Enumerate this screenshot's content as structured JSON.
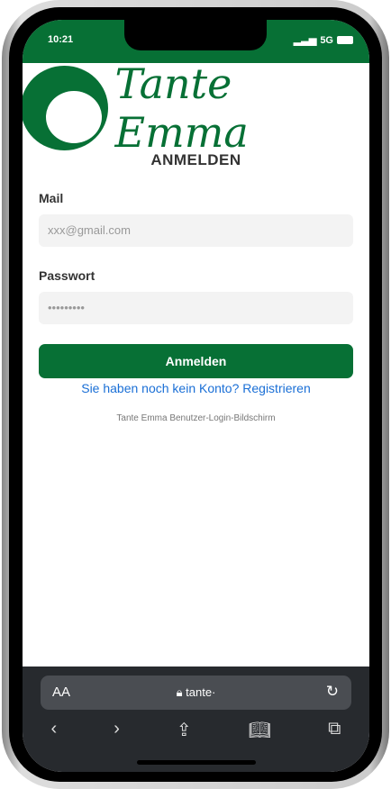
{
  "status": {
    "time": "10:21",
    "network": "5G"
  },
  "brand": {
    "logo_text": "Tante Emma"
  },
  "page": {
    "title": "ANMELDEN",
    "mail_label": "Mail",
    "mail_placeholder": "xxx@gmail.com",
    "password_label": "Passwort",
    "password_value": "•••••••••",
    "submit": "Anmelden",
    "register_link": "Sie haben noch kein Konto? Registrieren",
    "footer": "Tante Emma Benutzer-Login-Bildschirm"
  },
  "browser": {
    "aa": "AA",
    "url": "tante·",
    "icons": [
      "lock-icon",
      "reload-icon",
      "back-icon",
      "forward-icon",
      "share-icon",
      "bookmarks-icon",
      "tabs-icon"
    ]
  },
  "colors": {
    "brand": "#077035",
    "link": "#1a6fd6"
  }
}
